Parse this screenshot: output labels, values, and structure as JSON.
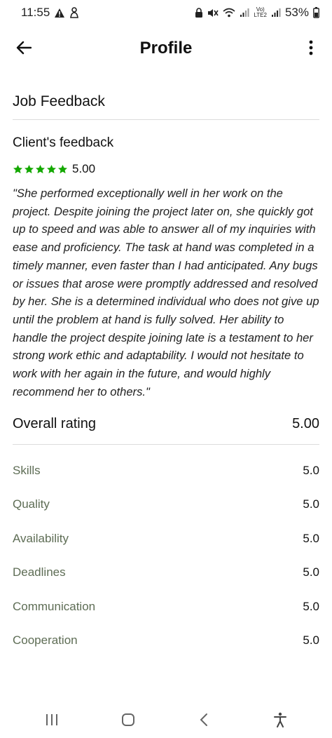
{
  "status_bar": {
    "time": "11:55",
    "battery": "53%",
    "left_icons": [
      "warning-icon",
      "notification-icon"
    ],
    "right_icons": [
      "lock-icon",
      "mute-icon",
      "wifi-icon",
      "signal-icon",
      "volte-icon",
      "signal-icon",
      "battery-icon"
    ],
    "volte": "Vo)",
    "volte_sub": "LTE2"
  },
  "app_bar": {
    "title": "Profile"
  },
  "feedback": {
    "section_title": "Job Feedback",
    "client_title": "Client's feedback",
    "rating": "5.00",
    "stars": 5,
    "star_color": "#14a800",
    "text": "\"She performed exceptionally well in her work on the project. Despite joining the project later on, she quickly got up to speed and was able to answer all of my inquiries with ease and proficiency. The task at hand was completed in a timely manner, even faster than I had anticipated. Any bugs or issues that arose were promptly addressed and resolved by her. She is a determined individual who does not give up until the problem at hand is fully solved. Her ability to handle the project despite joining late is a testament to her strong work ethic and adaptability. I would not hesitate to work with her again in the future, and would highly recommend her to others.\""
  },
  "overall": {
    "label": "Overall rating",
    "value": "5.00"
  },
  "metrics": [
    {
      "label": "Skills",
      "value": "5.0"
    },
    {
      "label": "Quality",
      "value": "5.0"
    },
    {
      "label": "Availability",
      "value": "5.0"
    },
    {
      "label": "Deadlines",
      "value": "5.0"
    },
    {
      "label": "Communication",
      "value": "5.0"
    },
    {
      "label": "Cooperation",
      "value": "5.0"
    }
  ],
  "nav_bar": {
    "icons": [
      "recent-apps-icon",
      "home-icon",
      "back-nav-icon",
      "accessibility-icon"
    ]
  }
}
